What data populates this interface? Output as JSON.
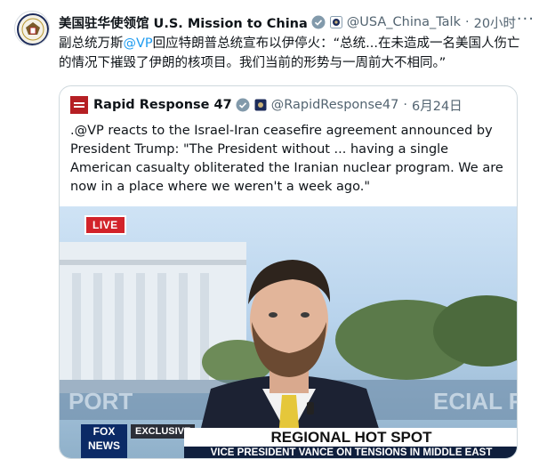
{
  "tweet": {
    "author_name": "美国驻华使领馆 U.S. Mission to China",
    "handle": "@USA_China_Talk",
    "time": "20小时",
    "more": "···",
    "text_prefix": "副总统万斯",
    "mention": "@VP",
    "text_suffix": "回应特朗普总统宣布以伊停火：“总统...在未造成一名美国人伤亡的情况下摧毁了伊朗的核项目。我们当前的形势与一周前大不相同。”"
  },
  "quoted": {
    "author_name": "Rapid Response 47",
    "handle": "@RapidResponse47",
    "date": "6月24日",
    "text": ".@VP reacts to the Israel-Iran ceasefire agreement announced by President Trump: \"The President without ... having a single American casualty obliterated the Iranian nuclear program. We are now in a place where we weren't a week ago.\""
  },
  "video": {
    "live_label": "LIVE",
    "exclusive_label": "EXCLUSIVE",
    "headline": "REGIONAL HOT SPOT",
    "subline": "VICE PRESIDENT VANCE ON TENSIONS IN MIDDLE EAST",
    "network": "FOX NEWS"
  },
  "colors": {
    "accent": "#1d9bf0",
    "verified": "#829aab",
    "text": "#0f1419",
    "muted": "#536471"
  },
  "icons": {
    "verified": "verified-badge-icon",
    "flag": "government-flag-icon",
    "more": "more-options-icon"
  }
}
